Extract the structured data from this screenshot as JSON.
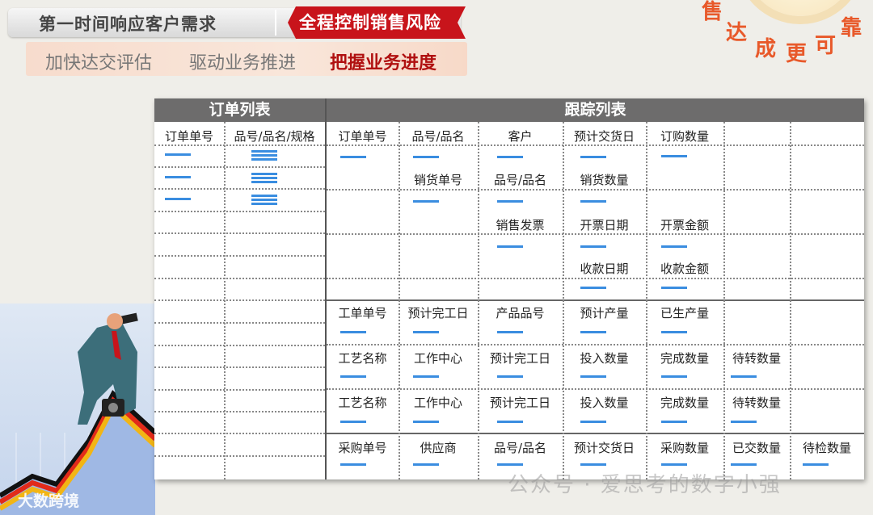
{
  "header": {
    "title": "第一时间响应客户需求",
    "flag": "全程控制销售风险",
    "sub_items": [
      "加快达交评估",
      "驱动业务推进",
      "把握业务进度"
    ],
    "arc_text": [
      "售",
      "达",
      "成",
      "更",
      "可",
      "靠"
    ]
  },
  "order_list": {
    "title": "订单列表",
    "columns": [
      "订单单号",
      "品号/品名/规格"
    ]
  },
  "tracking_list": {
    "title": "跟踪列表",
    "order": {
      "headers": [
        "订单单号",
        "品号/品名",
        "客户",
        "预计交货日",
        "订购数量"
      ]
    },
    "sales": {
      "headers": [
        "销货单号",
        "品号/品名",
        "销货数量"
      ]
    },
    "invoice": {
      "headers": [
        "销售发票",
        "开票日期",
        "开票金额"
      ]
    },
    "receipt": {
      "headers": [
        "收款日期",
        "收款金额"
      ]
    },
    "work_order": {
      "headers": [
        "工单单号",
        "预计完工日",
        "产品品号",
        "预计产量",
        "已生产量"
      ]
    },
    "process1": {
      "headers": [
        "工艺名称",
        "工作中心",
        "预计完工日",
        "投入数量",
        "完成数量",
        "待转数量"
      ]
    },
    "process2": {
      "headers": [
        "工艺名称",
        "工作中心",
        "预计完工日",
        "投入数量",
        "完成数量",
        "待转数量"
      ]
    },
    "purchase": {
      "headers": [
        "采购单号",
        "供应商",
        "品号/品名",
        "预计交货日",
        "采购数量",
        "已交数量",
        "待检数量"
      ]
    }
  },
  "watermarks": {
    "left": "大数跨境",
    "right": "公众号 · 爱思考的数字小强"
  },
  "colors": {
    "accent_red": "#c8141b",
    "header_gray": "#6d6c6c",
    "line_blue": "#3a8de0"
  }
}
